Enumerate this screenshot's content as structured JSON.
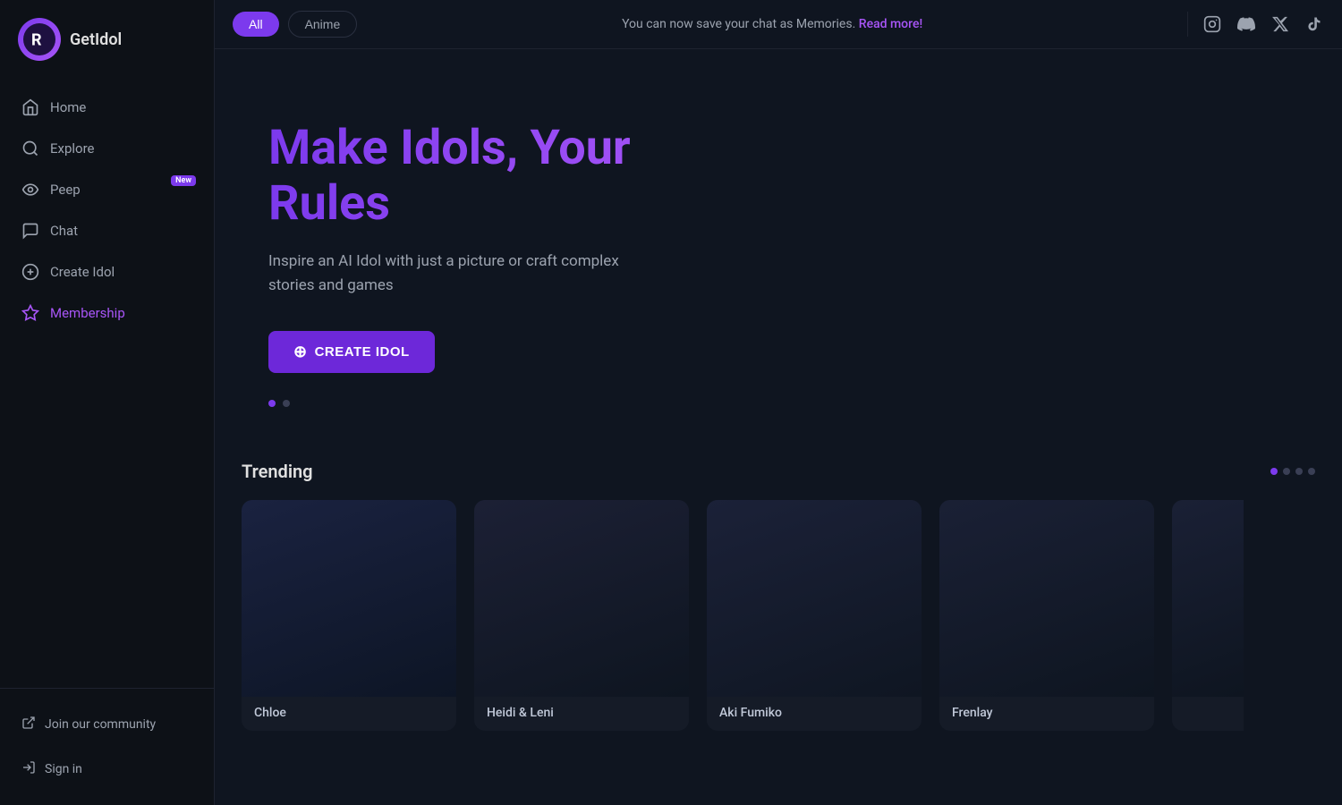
{
  "logo": {
    "text": "GetIdol"
  },
  "sidebar": {
    "items": [
      {
        "id": "home",
        "label": "Home",
        "icon": "home-icon"
      },
      {
        "id": "explore",
        "label": "Explore",
        "icon": "explore-icon"
      },
      {
        "id": "peep",
        "label": "Peep",
        "icon": "peep-icon",
        "badge": "New"
      },
      {
        "id": "chat",
        "label": "Chat",
        "icon": "chat-icon"
      },
      {
        "id": "create-idol",
        "label": "Create Idol",
        "icon": "create-icon"
      },
      {
        "id": "membership",
        "label": "Membership",
        "icon": "membership-icon"
      }
    ],
    "bottom": {
      "community": "Join our community",
      "sign_in": "Sign in"
    }
  },
  "topbar": {
    "filters": [
      {
        "label": "All",
        "active": true
      },
      {
        "label": "Anime",
        "active": false
      }
    ],
    "notice": "You can now save your chat as Memories.",
    "notice_link": "Read more!",
    "icons": [
      "instagram-icon",
      "discord-icon",
      "twitter-icon",
      "tiktok-icon"
    ]
  },
  "hero": {
    "title": "Make Idols, Your Rules",
    "subtitle": "Inspire an AI Idol with just a picture or craft complex stories and games",
    "cta_label": "CREATE IDOL"
  },
  "hero_dots": [
    {
      "active": true
    },
    {
      "active": false
    }
  ],
  "trending": {
    "title": "Trending",
    "dots": [
      {
        "active": true
      },
      {
        "active": false
      },
      {
        "active": false
      },
      {
        "active": false
      }
    ],
    "cards": [
      {
        "name": "Chloe"
      },
      {
        "name": "Heidi & Leni"
      },
      {
        "name": "Aki Fumiko"
      },
      {
        "name": "Frenlay"
      }
    ]
  }
}
